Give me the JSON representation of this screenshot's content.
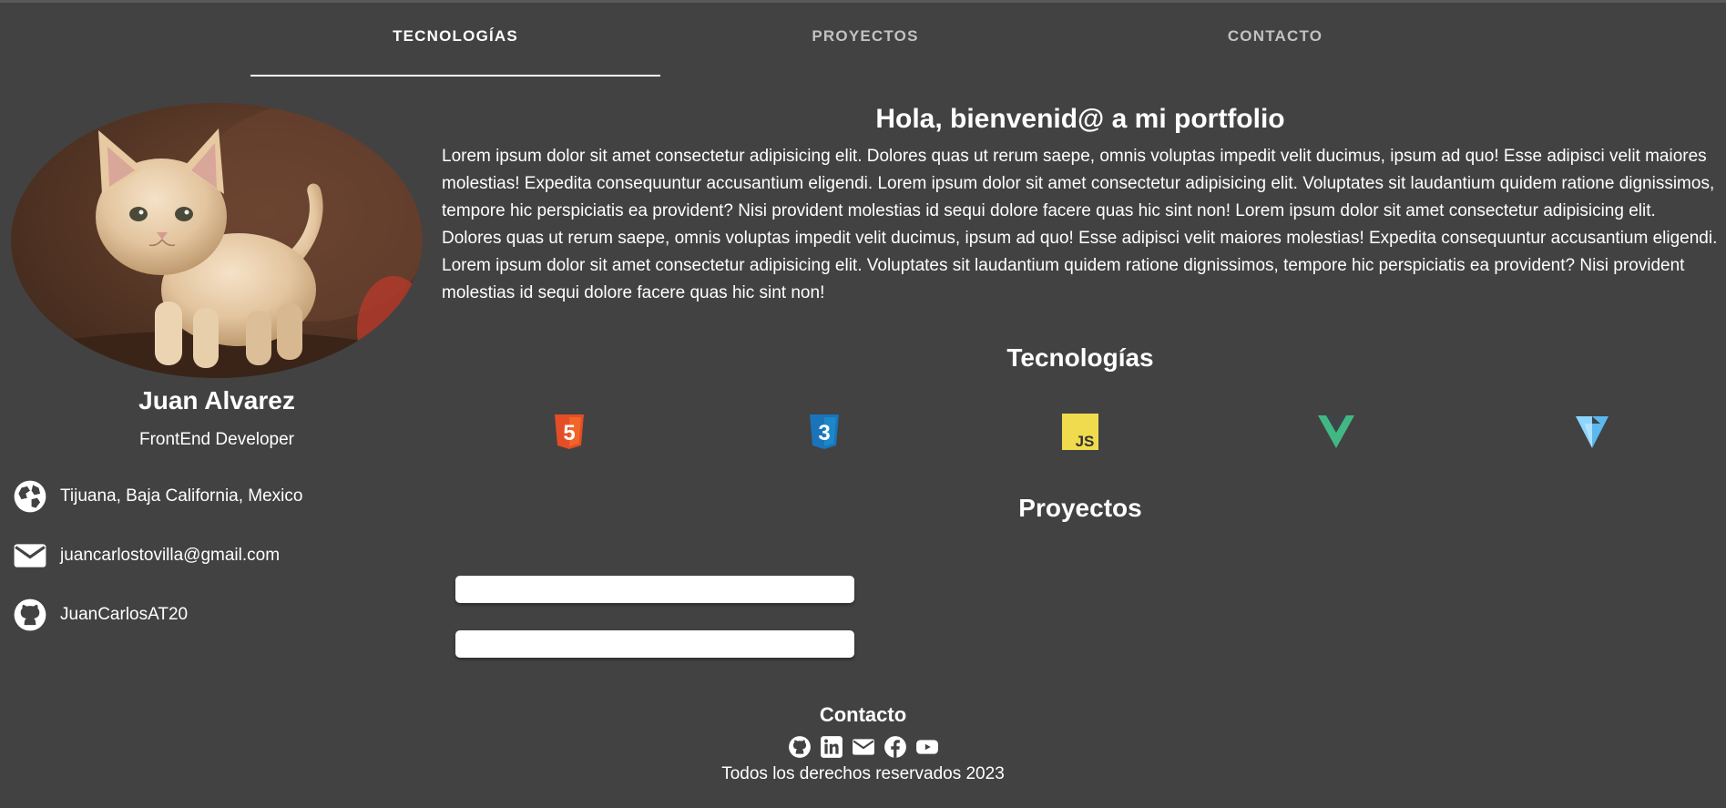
{
  "nav": {
    "tabs": [
      {
        "label": "TECNOLOGÍAS",
        "active": true
      },
      {
        "label": "PROYECTOS",
        "active": false
      },
      {
        "label": "CONTACTO",
        "active": false
      }
    ]
  },
  "profile": {
    "name": "Juan Alvarez",
    "role": "FrontEnd Developer",
    "location": "Tijuana, Baja California, Mexico",
    "email": "juancarlostovilla@gmail.com",
    "github": "JuanCarlosAT20"
  },
  "main": {
    "greeting": "Hola, bienvenid@ a mi portfolio",
    "bio": "Lorem ipsum dolor sit amet consectetur adipisicing elit. Dolores quas ut rerum saepe, omnis voluptas impedit velit ducimus, ipsum ad quo! Esse adipisci velit maiores molestias! Expedita consequuntur accusantium eligendi. Lorem ipsum dolor sit amet consectetur adipisicing elit. Voluptates sit laudantium quidem ratione dignissimos, tempore hic perspiciatis ea provident? Nisi provident molestias id sequi dolore facere quas hic sint non! Lorem ipsum dolor sit amet consectetur adipisicing elit. Dolores quas ut rerum saepe, omnis voluptas impedit velit ducimus, ipsum ad quo! Esse adipisci velit maiores molestias! Expedita consequuntur accusantium eligendi. Lorem ipsum dolor sit amet consectetur adipisicing elit. Voluptates sit laudantium quidem ratione dignissimos, tempore hic perspiciatis ea provident? Nisi provident molestias id sequi dolore facere quas hic sint non!",
    "technologies_title": "Tecnologías",
    "technologies": [
      {
        "icon": "html5-icon",
        "color": "#e44d26",
        "text": "5"
      },
      {
        "icon": "css3-icon",
        "color": "#1b73ba",
        "text": "3"
      },
      {
        "icon": "javascript-icon",
        "color": "#f0db4f",
        "text": "JS"
      },
      {
        "icon": "vue-icon",
        "color": "#41b883"
      },
      {
        "icon": "vuetify-icon",
        "color": "#8cd5ff"
      }
    ],
    "projects_title": "Proyectos"
  },
  "footer": {
    "title": "Contacto",
    "icons": [
      "github-icon",
      "linkedin-icon",
      "mail-icon",
      "facebook-icon",
      "youtube-icon"
    ],
    "copyright": "Todos los derechos reservados 2023"
  },
  "colors": {
    "background": "#424242",
    "text": "#ffffff",
    "tab_inactive": "#c2c2c2"
  }
}
